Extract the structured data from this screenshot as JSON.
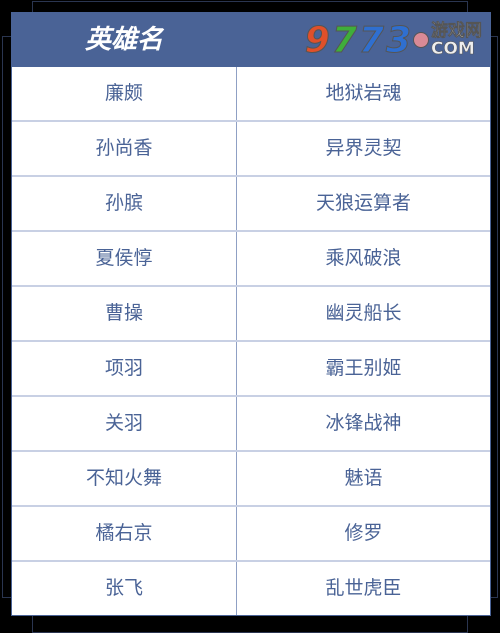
{
  "header": {
    "col1": "英雄名",
    "logo": {
      "digits": [
        "9",
        "7",
        "3"
      ],
      "site_top": "游戏网",
      "site_bottom": "COM",
      "colors": [
        "#e0502a",
        "#3fae3a",
        "#2f6fd0"
      ]
    }
  },
  "rows": [
    [
      "廉颇",
      "地狱岩魂"
    ],
    [
      "孙尚香",
      "异界灵契"
    ],
    [
      "孙膑",
      "天狼运算者"
    ],
    [
      "夏侯惇",
      "乘风破浪"
    ],
    [
      "曹操",
      "幽灵船长"
    ],
    [
      "项羽",
      "霸王别姬"
    ],
    [
      "关羽",
      "冰锋战神"
    ],
    [
      "不知火舞",
      "魅语"
    ],
    [
      "橘右京",
      "修罗"
    ],
    [
      "张飞",
      "乱世虎臣"
    ]
  ]
}
